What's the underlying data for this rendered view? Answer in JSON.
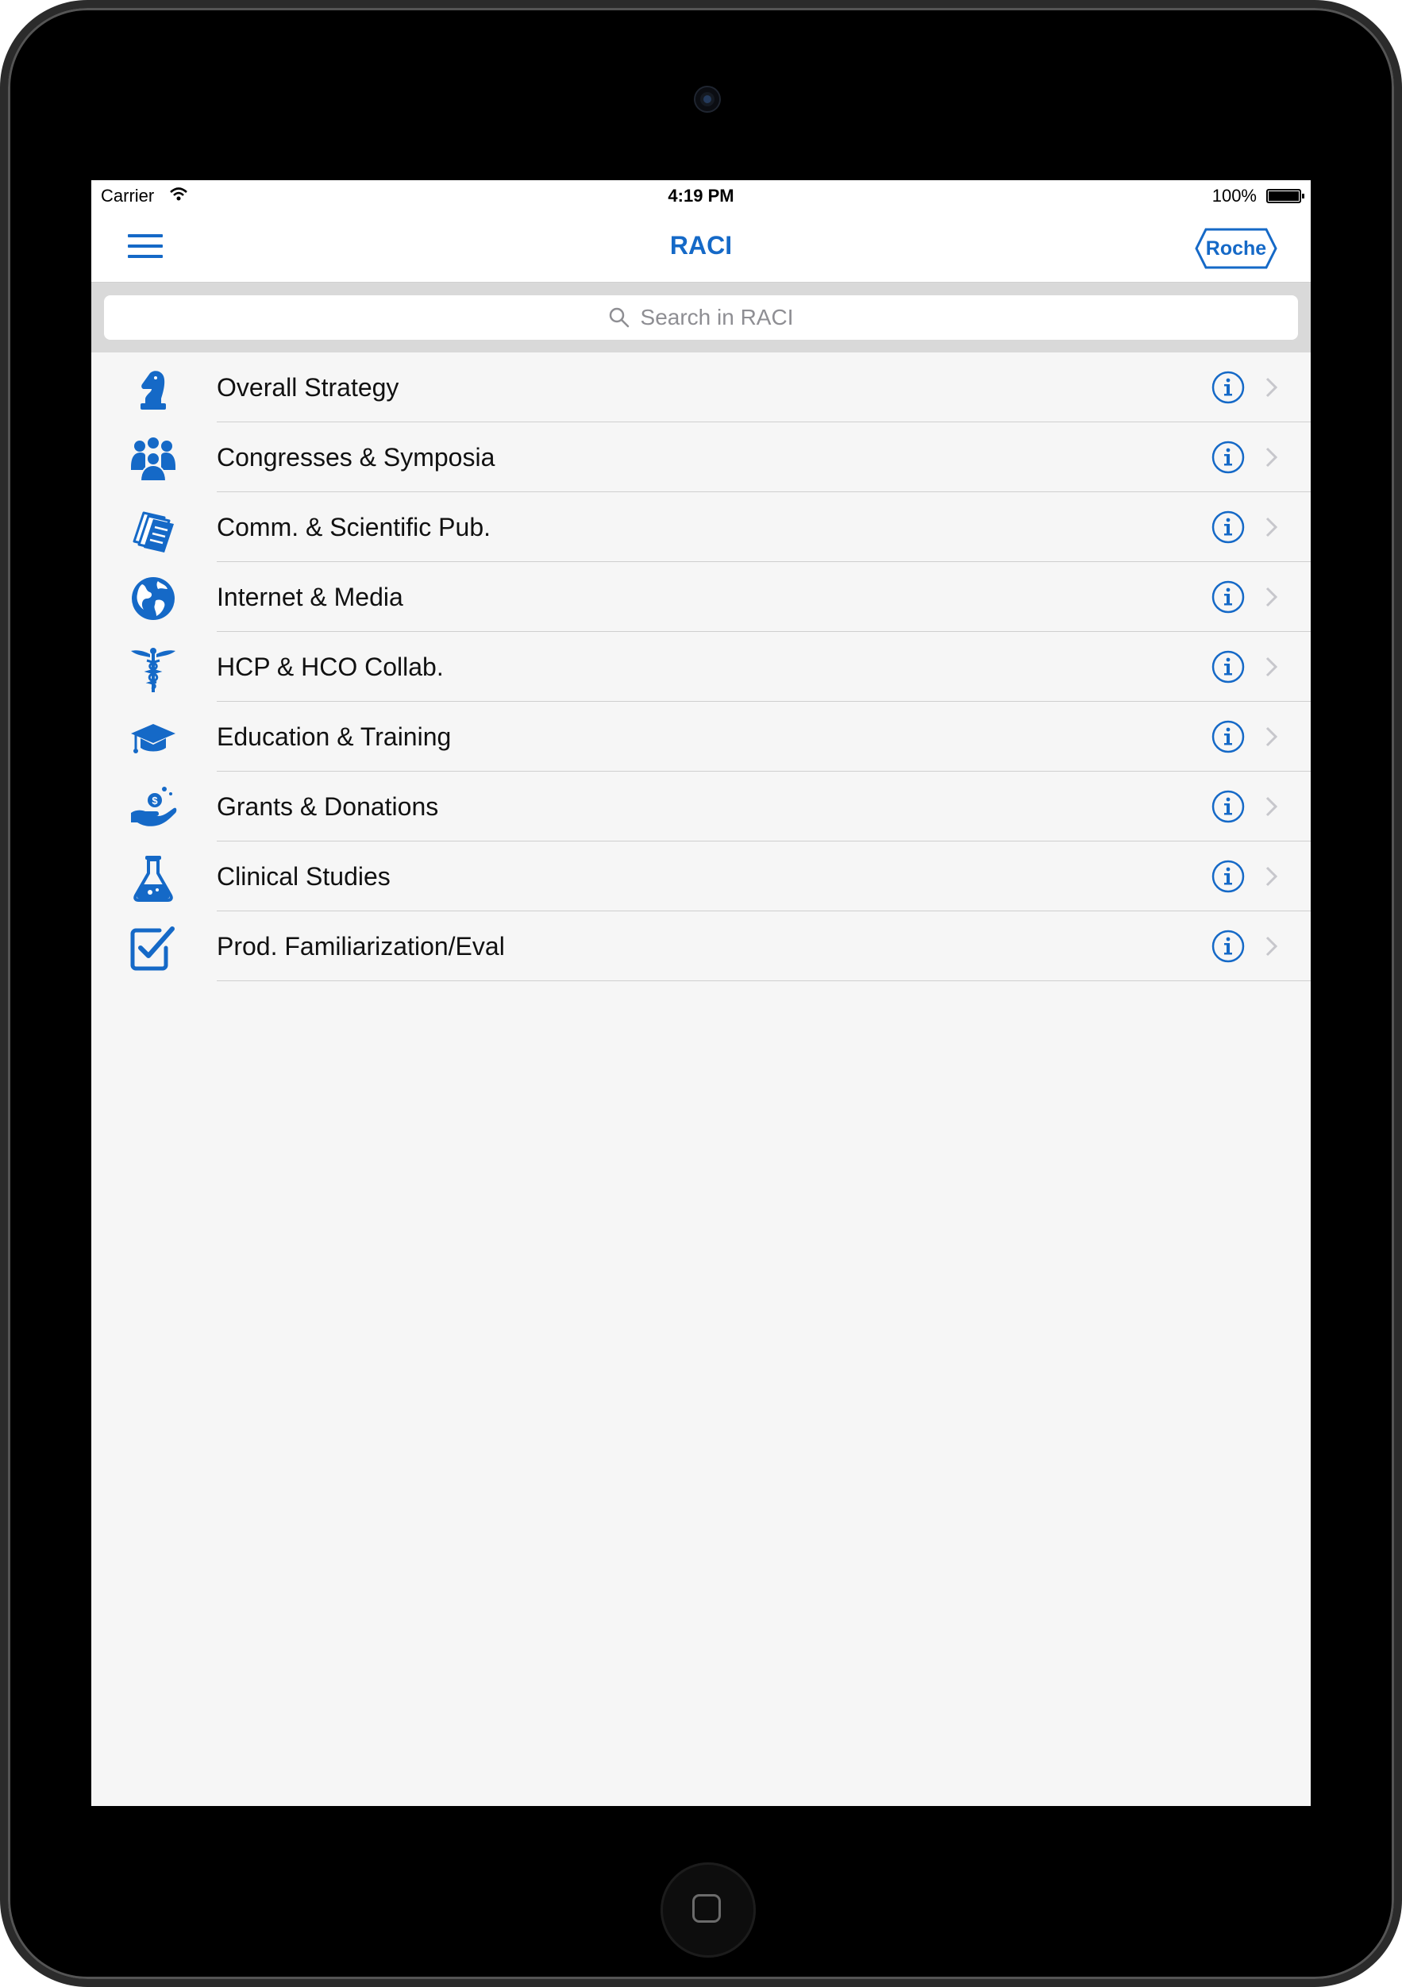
{
  "status_bar": {
    "carrier": "Carrier",
    "time": "4:19 PM",
    "battery": "100%"
  },
  "nav": {
    "title": "RACI",
    "logo_text": "Roche",
    "menu_icon": "hamburger-menu-icon"
  },
  "search": {
    "placeholder": "Search in RACI",
    "icon": "search-icon"
  },
  "colors": {
    "accent": "#1569c7",
    "background": "#f6f6f6",
    "separator": "#cfcfcf"
  },
  "items": [
    {
      "label": "Overall Strategy",
      "icon": "chess-knight-icon"
    },
    {
      "label": "Congresses & Symposia",
      "icon": "people-group-icon"
    },
    {
      "label": "Comm. & Scientific Pub.",
      "icon": "publications-icon"
    },
    {
      "label": "Internet & Media",
      "icon": "globe-icon"
    },
    {
      "label": "HCP & HCO Collab.",
      "icon": "caduceus-icon"
    },
    {
      "label": "Education & Training",
      "icon": "graduation-cap-icon"
    },
    {
      "label": "Grants & Donations",
      "icon": "hand-coin-icon"
    },
    {
      "label": "Clinical Studies",
      "icon": "flask-icon"
    },
    {
      "label": "Prod. Familiarization/Eval",
      "icon": "checkbox-icon"
    }
  ]
}
